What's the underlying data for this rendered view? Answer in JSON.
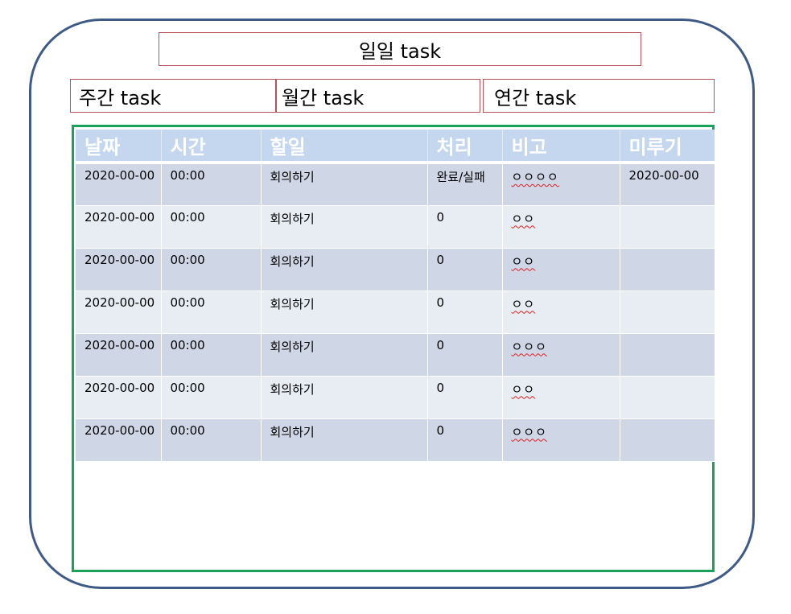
{
  "tabs": {
    "daily": "일일 task",
    "weekly": "주간 task",
    "monthly": "월간 task",
    "yearly": "연간 task"
  },
  "table": {
    "headers": [
      "날짜",
      "시간",
      "할일",
      "처리",
      "비고",
      "미루기"
    ],
    "rows": [
      [
        "2020-00-00",
        "00:00",
        "회의하기",
        "완료/실패",
        "ㅇㅇㅇㅇ",
        "2020-00-00"
      ],
      [
        "2020-00-00",
        "00:00",
        "회의하기",
        "0",
        "ㅇㅇ",
        ""
      ],
      [
        "2020-00-00",
        "00:00",
        "회의하기",
        "0",
        "ㅇㅇ",
        ""
      ],
      [
        "2020-00-00",
        "00:00",
        "회의하기",
        "0",
        "ㅇㅇ",
        ""
      ],
      [
        "2020-00-00",
        "00:00",
        "회의하기",
        "0",
        "ㅇㅇㅇ",
        ""
      ],
      [
        "2020-00-00",
        "00:00",
        "회의하기",
        "0",
        "ㅇㅇ",
        ""
      ],
      [
        "2020-00-00",
        "00:00",
        "회의하기",
        "0",
        "ㅇㅇㅇ",
        ""
      ]
    ]
  },
  "colors": {
    "frame": "#3e5a86",
    "tab_border": "#b5535a",
    "board_border": "#1aa25a",
    "header_bg": "#c5d7ee",
    "row_odd": "#cfd7e7",
    "row_even": "#e8edf4"
  }
}
